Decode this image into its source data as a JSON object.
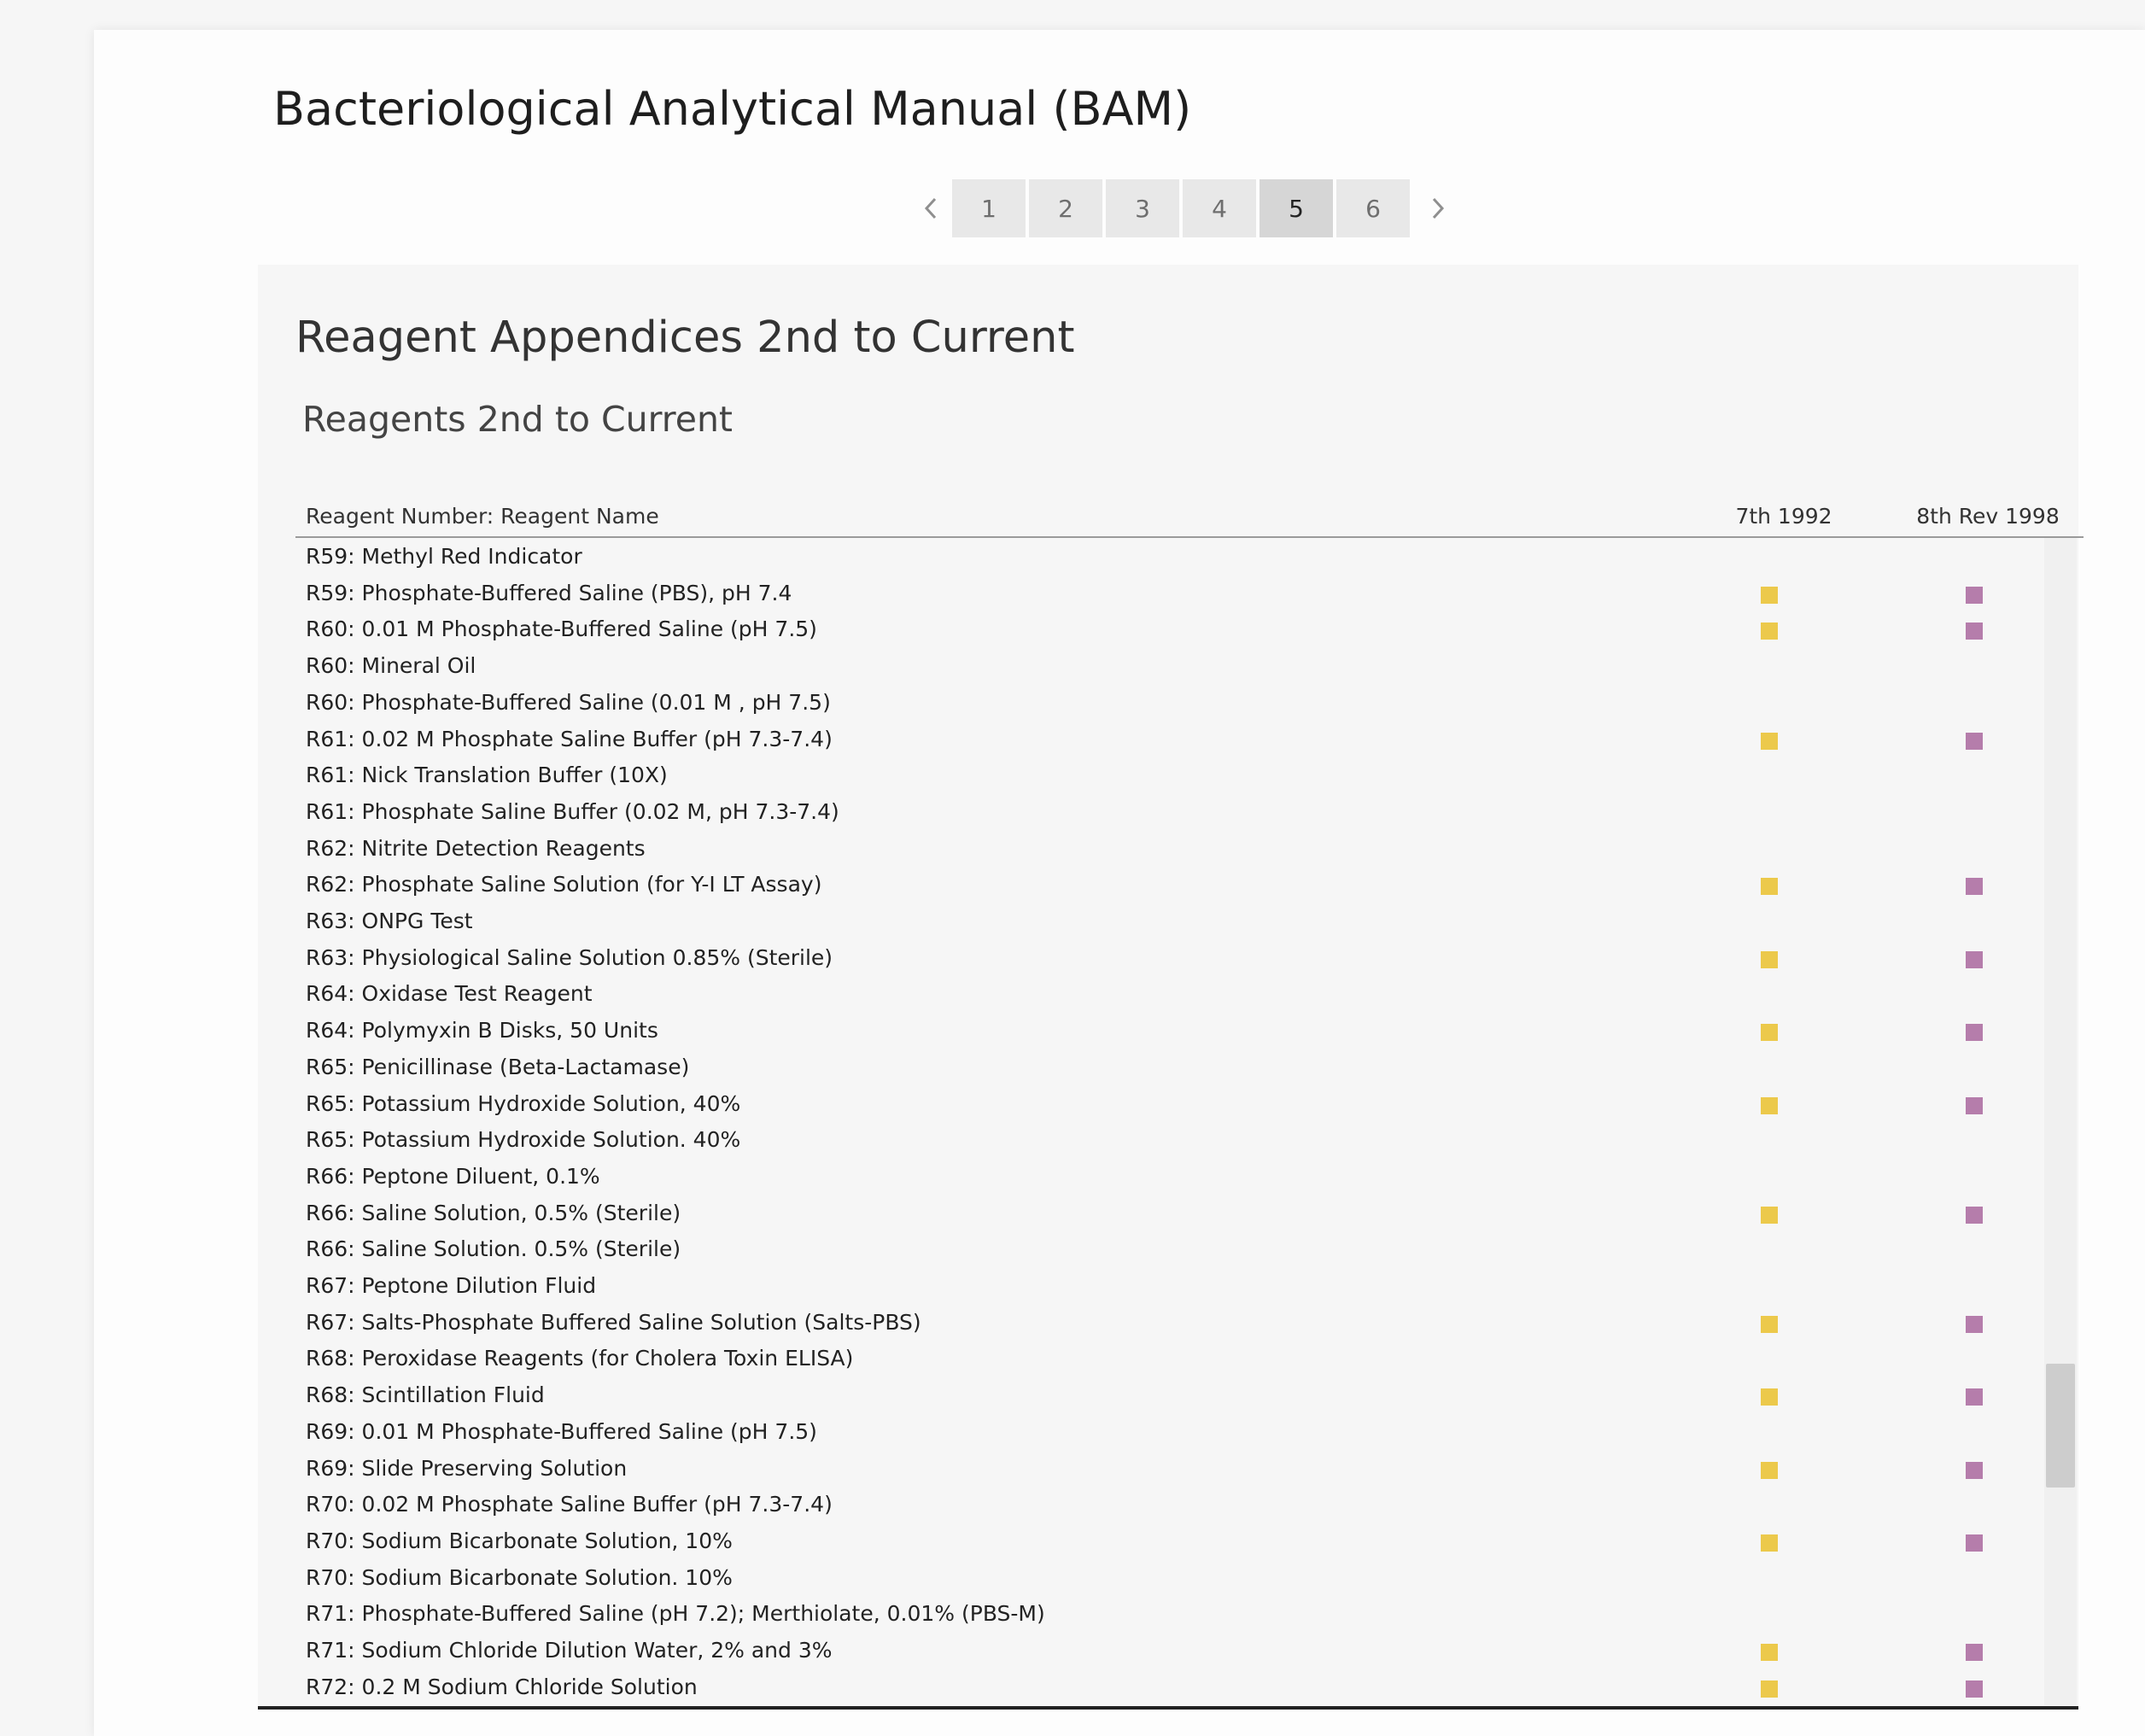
{
  "header": {
    "title": "Bacteriological Analytical Manual (BAM)"
  },
  "pager": {
    "prev_symbol": "‹",
    "next_symbol": "›",
    "pages": [
      "1",
      "2",
      "3",
      "4",
      "5",
      "6"
    ],
    "active_page": "5"
  },
  "dashboard": {
    "section_title": "Reagent Appendices 2nd to Current",
    "sheet_title": "Reagents 2nd to Current"
  },
  "table": {
    "columns": [
      "Reagent Number: Reagent Name",
      "7th 1992",
      "8th Rev 1998"
    ],
    "colors": {
      "7th 1992": "#ecc94b",
      "8th Rev 1998": "#b57dab"
    },
    "rows": [
      {
        "name": "R59: Methyl Red Indicator",
        "ed7": false,
        "ed8": false
      },
      {
        "name": "R59: Phosphate-Buffered Saline (PBS), pH 7.4",
        "ed7": true,
        "ed8": true
      },
      {
        "name": "R60: 0.01 M Phosphate-Buffered Saline (pH 7.5)",
        "ed7": true,
        "ed8": true
      },
      {
        "name": "R60: Mineral Oil",
        "ed7": false,
        "ed8": false
      },
      {
        "name": "R60: Phosphate-Buffered Saline (0.01 M , pH 7.5)",
        "ed7": false,
        "ed8": false
      },
      {
        "name": "R61: 0.02 M Phosphate Saline Buffer (pH 7.3-7.4)",
        "ed7": true,
        "ed8": true
      },
      {
        "name": "R61: Nick Translation Buffer (10X)",
        "ed7": false,
        "ed8": false
      },
      {
        "name": "R61: Phosphate Saline Buffer (0.02 M, pH 7.3-7.4)",
        "ed7": false,
        "ed8": false
      },
      {
        "name": "R62: Nitrite Detection Reagents",
        "ed7": false,
        "ed8": false
      },
      {
        "name": "R62: Phosphate Saline Solution (for Y-I LT Assay)",
        "ed7": true,
        "ed8": true
      },
      {
        "name": "R63: ONPG Test",
        "ed7": false,
        "ed8": false
      },
      {
        "name": "R63: Physiological Saline Solution 0.85% (Sterile)",
        "ed7": true,
        "ed8": true
      },
      {
        "name": "R64: Oxidase Test Reagent",
        "ed7": false,
        "ed8": false
      },
      {
        "name": "R64: Polymyxin B Disks, 50 Units",
        "ed7": true,
        "ed8": true
      },
      {
        "name": "R65: Penicillinase (Beta-Lactamase)",
        "ed7": false,
        "ed8": false
      },
      {
        "name": "R65: Potassium Hydroxide Solution, 40%",
        "ed7": true,
        "ed8": true
      },
      {
        "name": "R65: Potassium Hydroxide Solution. 40%",
        "ed7": false,
        "ed8": false
      },
      {
        "name": "R66: Peptone Diluent, 0.1%",
        "ed7": false,
        "ed8": false
      },
      {
        "name": "R66: Saline Solution, 0.5% (Sterile)",
        "ed7": true,
        "ed8": true
      },
      {
        "name": "R66: Saline Solution. 0.5% (Sterile)",
        "ed7": false,
        "ed8": false
      },
      {
        "name": "R67: Peptone Dilution Fluid",
        "ed7": false,
        "ed8": false
      },
      {
        "name": "R67: Salts-Phosphate Buffered Saline Solution (Salts-PBS)",
        "ed7": true,
        "ed8": true
      },
      {
        "name": "R68: Peroxidase Reagents (for Cholera Toxin ELISA)",
        "ed7": false,
        "ed8": false
      },
      {
        "name": "R68: Scintillation Fluid",
        "ed7": true,
        "ed8": true
      },
      {
        "name": "R69: 0.01 M Phosphate-Buffered Saline (pH 7.5)",
        "ed7": false,
        "ed8": false
      },
      {
        "name": "R69: Slide Preserving Solution",
        "ed7": true,
        "ed8": true
      },
      {
        "name": "R70: 0.02 M Phosphate Saline Buffer (pH 7.3-7.4)",
        "ed7": false,
        "ed8": false
      },
      {
        "name": "R70: Sodium Bicarbonate Solution, 10%",
        "ed7": true,
        "ed8": true
      },
      {
        "name": "R70: Sodium Bicarbonate Solution. 10%",
        "ed7": false,
        "ed8": false
      },
      {
        "name": "R71: Phosphate-Buffered Saline (pH 7.2); Merthiolate, 0.01% (PBS-M)",
        "ed7": false,
        "ed8": false
      },
      {
        "name": "R71: Sodium Chloride Dilution Water, 2% and 3%",
        "ed7": true,
        "ed8": true
      },
      {
        "name": "R72: 0.2 M Sodium Chloride Solution",
        "ed7": true,
        "ed8": true
      }
    ]
  }
}
